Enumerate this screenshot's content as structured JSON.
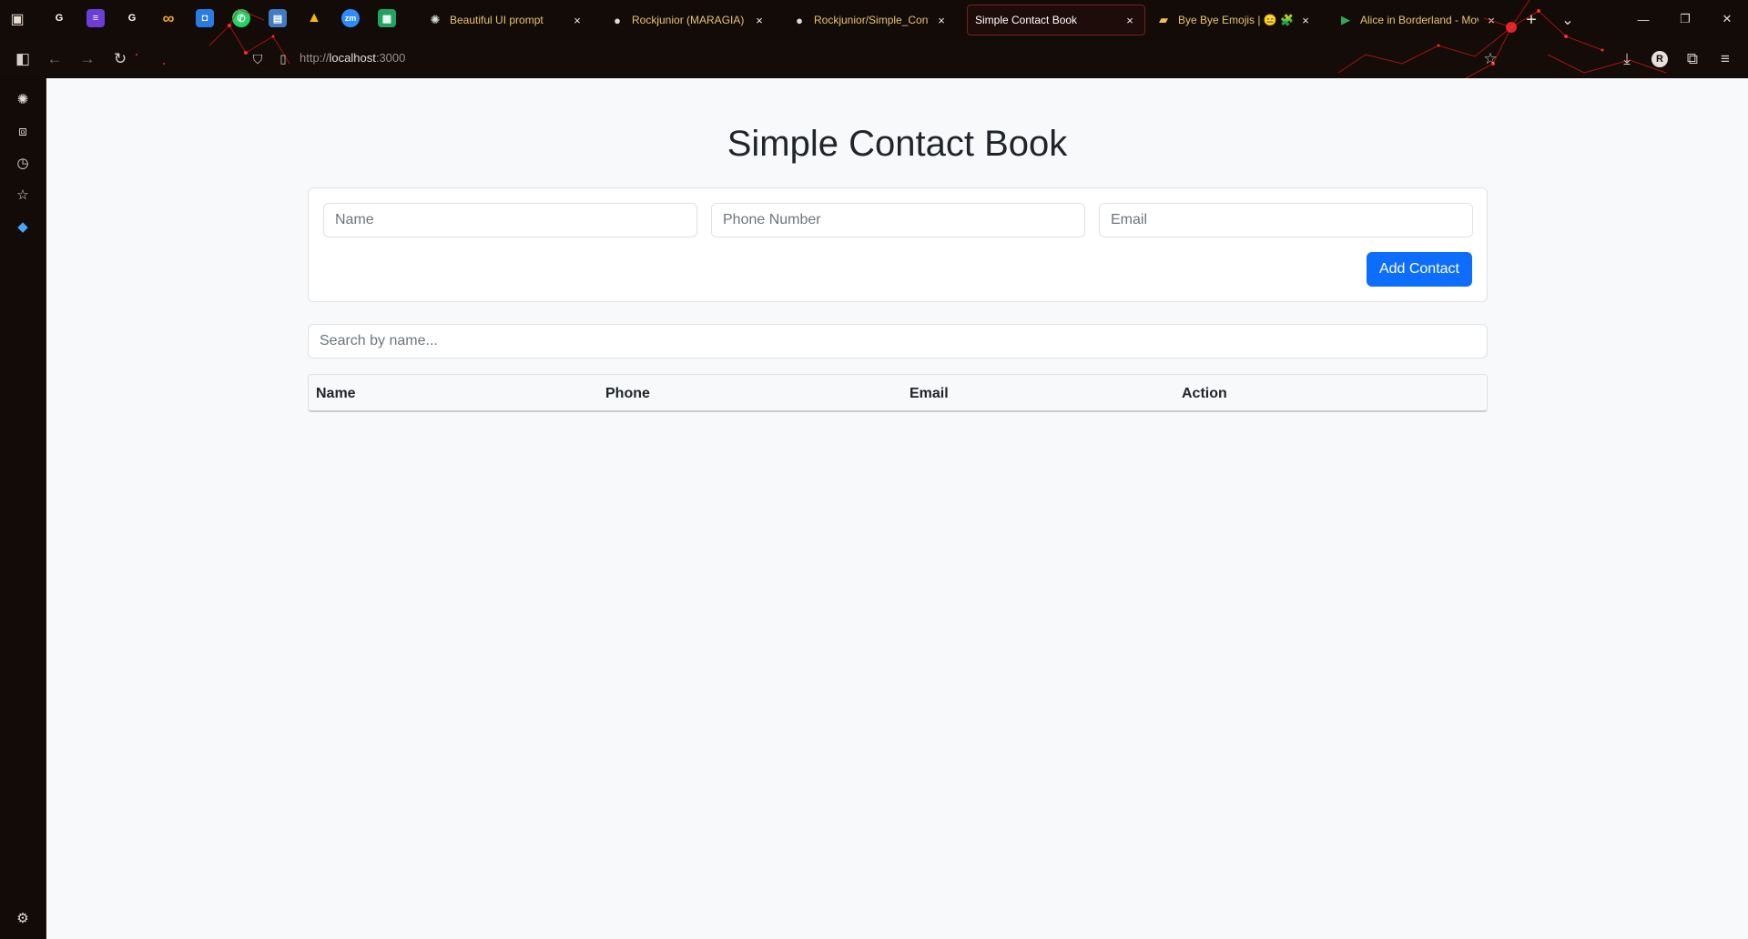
{
  "browser": {
    "pinned_tabs": [
      {
        "icon": "google-icon",
        "glyph": "G",
        "color": "#ffffff",
        "bg": "#1e1e1e"
      },
      {
        "icon": "tasks-icon",
        "glyph": "≡",
        "color": "#ffffff",
        "bg": "#6b3fd6"
      },
      {
        "icon": "google-icon",
        "glyph": "G",
        "color": "#ffffff",
        "bg": "#1e1e1e"
      },
      {
        "icon": "infinity-icon",
        "glyph": "∞",
        "color": "#f5a623",
        "bg": "transparent"
      },
      {
        "icon": "bot-icon",
        "glyph": "◘",
        "color": "#ffffff",
        "bg": "#2a7be4"
      },
      {
        "icon": "whatsapp-icon",
        "glyph": "✆",
        "color": "#ffffff",
        "bg": "#25d366"
      },
      {
        "icon": "document-icon",
        "glyph": "▤",
        "color": "#ffffff",
        "bg": "#3f7cc2"
      },
      {
        "icon": "drive-icon",
        "glyph": "▲",
        "color": "#fbbc04",
        "bg": "transparent"
      },
      {
        "icon": "zoom-icon",
        "glyph": "zm",
        "color": "#ffffff",
        "bg": "#2d8cff"
      },
      {
        "icon": "sheets-icon",
        "glyph": "▦",
        "color": "#ffffff",
        "bg": "#1fa463"
      }
    ],
    "tabs": [
      {
        "title": "Beautiful UI prompt",
        "icon": "openai-icon",
        "glyph": "✺",
        "active": false
      },
      {
        "title": "Rockjunior (MARAGIA)",
        "icon": "github-icon",
        "glyph": "●",
        "active": false
      },
      {
        "title": "Rockjunior/Simple_Contact",
        "icon": "github-icon",
        "glyph": "●",
        "active": false
      },
      {
        "title": "Simple Contact Book",
        "icon": "",
        "glyph": "",
        "active": true
      },
      {
        "title": "Bye Bye Emojis | 😑 🧩Bye",
        "icon": "folder-icon",
        "glyph": "▰",
        "active": false
      },
      {
        "title": "Alice in Borderland - Movie",
        "icon": "play-icon",
        "glyph": "▶",
        "active": false
      }
    ],
    "tab_close": "×",
    "new_tab": "+",
    "url": {
      "scheme": "http://",
      "host": "localhost",
      "port": ":3000"
    }
  },
  "app": {
    "title": "Simple Contact Book",
    "form": {
      "name_placeholder": "Name",
      "phone_placeholder": "Phone Number",
      "email_placeholder": "Email",
      "add_label": "Add Contact"
    },
    "search_placeholder": "Search by name...",
    "table": {
      "headers": [
        "Name",
        "Phone",
        "Email",
        "Action"
      ],
      "rows": []
    }
  },
  "colors": {
    "primary": "#0d6efd",
    "page_bg": "#f8f9fa",
    "chrome_bg": "#120b08",
    "tab_text": "#e9c46a"
  }
}
